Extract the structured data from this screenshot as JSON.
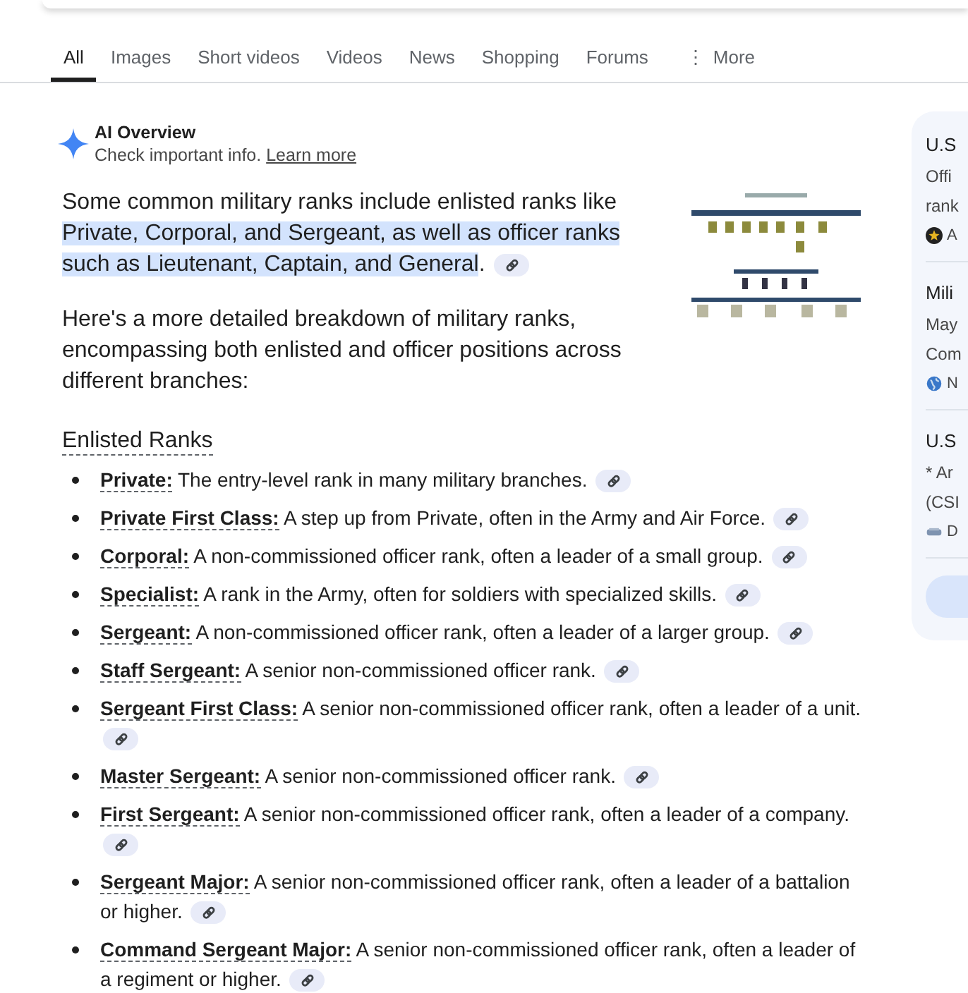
{
  "tabs": [
    {
      "label": "All",
      "selected": true
    },
    {
      "label": "Images",
      "selected": false
    },
    {
      "label": "Short videos",
      "selected": false
    },
    {
      "label": "Videos",
      "selected": false
    },
    {
      "label": "News",
      "selected": false
    },
    {
      "label": "Shopping",
      "selected": false
    },
    {
      "label": "Forums",
      "selected": false
    },
    {
      "label": "More",
      "selected": false,
      "icon": "⋮"
    }
  ],
  "ai_overview": {
    "title": "AI Overview",
    "subtitle": "Check important info.",
    "link": "Learn more",
    "intro": {
      "before": "Some common military ranks include enlisted ranks like",
      "highlight": [
        "Private, Corporal, and Sergeant, as well as officer ranks",
        "such as Lieutenant, Captain, and General"
      ],
      "after": "."
    },
    "paragraph": "Here's a more detailed breakdown of military ranks, encompassing both enlisted and officer positions across different branches:",
    "section_heading": "Enlisted Ranks",
    "items": [
      {
        "term": "Private:",
        "text": "The entry-level rank in many military branches."
      },
      {
        "term": "Private First Class:",
        "text": "A step up from Private, often in the Army and Air Force."
      },
      {
        "term": "Corporal:",
        "text": "A non-commissioned officer rank, often a leader of a small group."
      },
      {
        "term": "Specialist:",
        "text": "A rank in the Army, often for soldiers with specialized skills."
      },
      {
        "term": "Sergeant:",
        "text": "A non-commissioned officer rank, often a leader of a larger group."
      },
      {
        "term": "Staff Sergeant:",
        "text": "A senior non-commissioned officer rank."
      },
      {
        "term": "Sergeant First Class:",
        "text": "A senior non-commissioned officer rank, often a leader of a unit."
      },
      {
        "term": "Master Sergeant:",
        "text": "A senior non-commissioned officer rank."
      },
      {
        "term": "First Sergeant:",
        "text": "A senior non-commissioned officer rank, often a leader of a company."
      },
      {
        "term": "Sergeant Major:",
        "text": "A senior non-commissioned officer rank, often a leader of a battalion or higher."
      },
      {
        "term": "Command Sergeant Major:",
        "text": "A senior non-commissioned officer rank, often a leader of a regiment or higher."
      }
    ]
  },
  "side_panel": {
    "cards": [
      {
        "title": "U.S",
        "lines": [
          "Offi",
          "rank"
        ],
        "source": "A",
        "kind": "star"
      },
      {
        "title": "Mili",
        "lines": [
          "May",
          "Com"
        ],
        "source": "N",
        "kind": "globe"
      },
      {
        "title": "U.S",
        "lines": [
          "* Ar",
          "(CSI"
        ],
        "source": "D",
        "kind": "device"
      }
    ]
  }
}
